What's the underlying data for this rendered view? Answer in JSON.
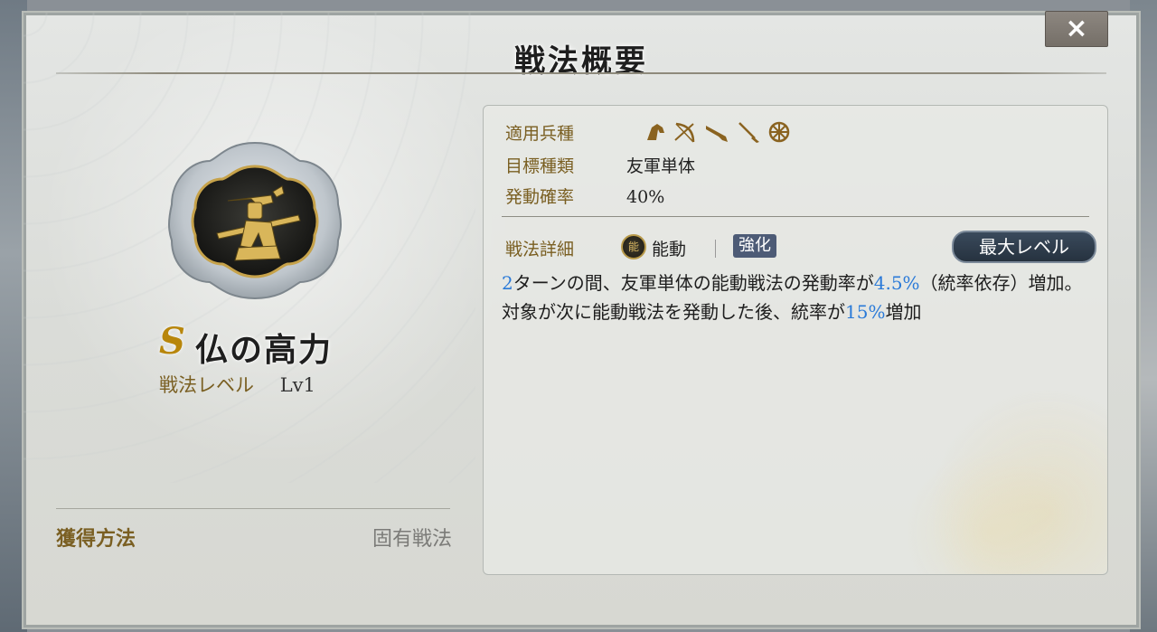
{
  "header": {
    "title": "戦法概要",
    "close_icon": "×"
  },
  "skill": {
    "rank": "S",
    "name": "仏の高力",
    "level_label": "戦法レベル",
    "level_value": "Lv1",
    "emblem_icon": "samurai-spear-emblem-icon"
  },
  "acquisition": {
    "label": "獲得方法",
    "value": "固有戦法"
  },
  "info": {
    "troop_type_label": "適用兵種",
    "troop_icons": [
      "cavalry-icon",
      "bow-icon",
      "gun-icon",
      "spear-icon",
      "wheel-icon"
    ],
    "target_label": "目標種類",
    "target_value": "友軍単体",
    "rate_label": "発動確率",
    "rate_value": "40%",
    "detail_label": "戦法詳細",
    "type_badge": "能",
    "type_value": "能動",
    "strengthen_label": "強化",
    "max_level_label": "最大レベル"
  },
  "description": {
    "parts": [
      {
        "text": "2",
        "highlight": true
      },
      {
        "text": "ターンの間、友軍単体の能動戦法の発動率が",
        "highlight": false
      },
      {
        "text": "4.5%",
        "highlight": true
      },
      {
        "text": "（統率依存）増加。対象が次に能動戦法を発動した後、統率が",
        "highlight": false
      },
      {
        "text": "15%",
        "highlight": true
      },
      {
        "text": "増加",
        "highlight": false
      }
    ]
  },
  "colors": {
    "accent_gold": "#7a5f22",
    "highlight_blue": "#2a7ad8",
    "badge_blue": "#4d5b76"
  }
}
